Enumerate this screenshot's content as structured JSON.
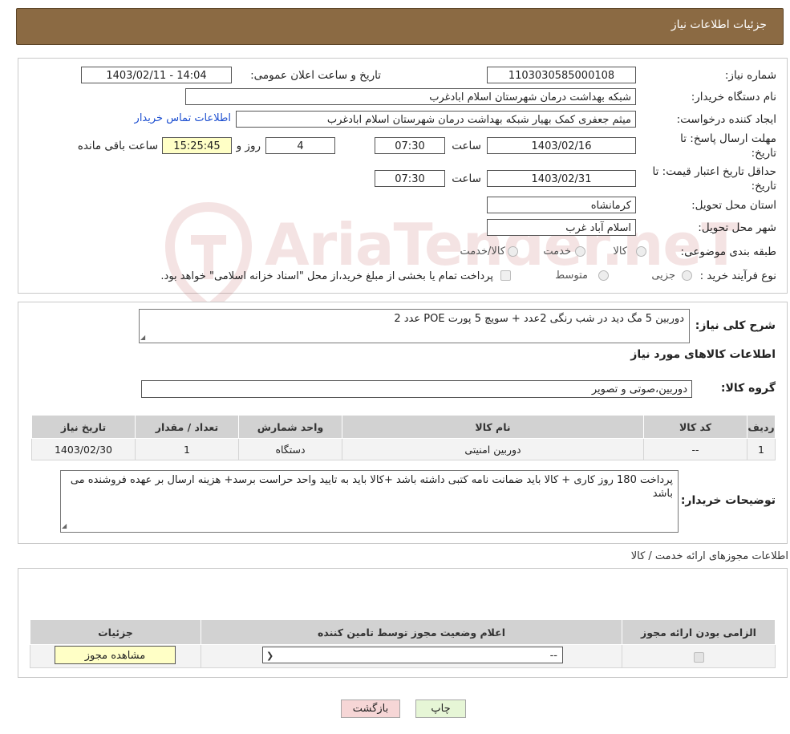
{
  "header": {
    "title": "جزئیات اطلاعات نیاز"
  },
  "watermark": {
    "text": "AriaTender.neT"
  },
  "form": {
    "need_number_label": "شماره نیاز:",
    "need_number_value": "1103030585000108",
    "announce_label": "تاریخ و ساعت اعلان عمومی:",
    "announce_value": "1403/02/11 - 14:04",
    "buyer_org_label": "نام دستگاه خریدار:",
    "buyer_org_value": "شبکه بهداشت درمان شهرستان اسلام ابادغرب",
    "creator_label": "ایجاد کننده درخواست:",
    "creator_value": "میثم جعفری کمک بهیار شبکه بهداشت درمان شهرستان اسلام ابادغرب",
    "contact_link": "اطلاعات تماس خریدار",
    "deadline_label_1": "مهلت ارسال پاسخ: تا",
    "deadline_label_2": "تاریخ:",
    "deadline_date": "1403/02/16",
    "time_label": "ساعت",
    "deadline_time": "07:30",
    "days_value": "4",
    "days_label": "روز و",
    "remaining_value": "15:25:45",
    "remaining_label": "ساعت باقی مانده",
    "validity_label_1": "حداقل تاریخ اعتبار قیمت: تا",
    "validity_label_2": "تاریخ:",
    "validity_date": "1403/02/31",
    "validity_time": "07:30",
    "province_label": "استان محل تحویل:",
    "province_value": "کرمانشاه",
    "city_label": "شهر محل تحویل:",
    "city_value": "اسلام آباد غرب",
    "category_label": "طبقه بندی موضوعی:",
    "category_options": [
      "کالا",
      "خدمت",
      "کالا/خدمت"
    ],
    "process_label": "نوع فرآیند خرید :",
    "process_options": [
      "جزیی",
      "متوسط"
    ],
    "process_note": "پرداخت تمام یا بخشی از مبلغ خرید،از محل \"اسناد خزانه اسلامی\" خواهد بود."
  },
  "details": {
    "summary_label": "شرح کلی نیاز:",
    "summary_value": "دوربین 5 مگ دید در شب رنگی 2عدد  + سویچ 5 پورت  POE  عدد 2",
    "goods_info_title": "اطلاعات کالاهای مورد نیاز",
    "group_label": "گروه کالا:",
    "group_value": "دوربین،صوتی و تصویر",
    "table_headers": [
      "ردیف",
      "کد کالا",
      "نام کالا",
      "واحد شمارش",
      "تعداد / مقدار",
      "تاریخ نیاز"
    ],
    "table_rows": [
      [
        "1",
        "--",
        "دوربین امنیتی",
        "دستگاه",
        "1",
        "1403/02/30"
      ]
    ],
    "buyer_notes_label": "توضیحات خریدار:",
    "buyer_notes_value": "پرداخت 180 روز کاری + کالا باید ضمانت نامه کتبی داشته باشد +کالا باید به تایید واحد حراست برسد+ هزینه ارسال بر عهده فروشنده می باشد"
  },
  "permits": {
    "title": "اطلاعات مجوزهای ارائه خدمت / کالا",
    "headers": [
      "الزامی بودن ارائه مجوز",
      "اعلام وضعیت مجوز توسط تامین کننده",
      "جزئیات"
    ],
    "select_value": "--",
    "view_button": "مشاهده مجوز"
  },
  "buttons": {
    "print": "چاپ",
    "back": "بازگشت"
  },
  "colors": {
    "header_bg": "#8b6a43",
    "link": "#1d4fd0",
    "yellow_box": "#ffffc6",
    "back_button": "#f6d6d6",
    "print_button": "#e6f6d6"
  }
}
